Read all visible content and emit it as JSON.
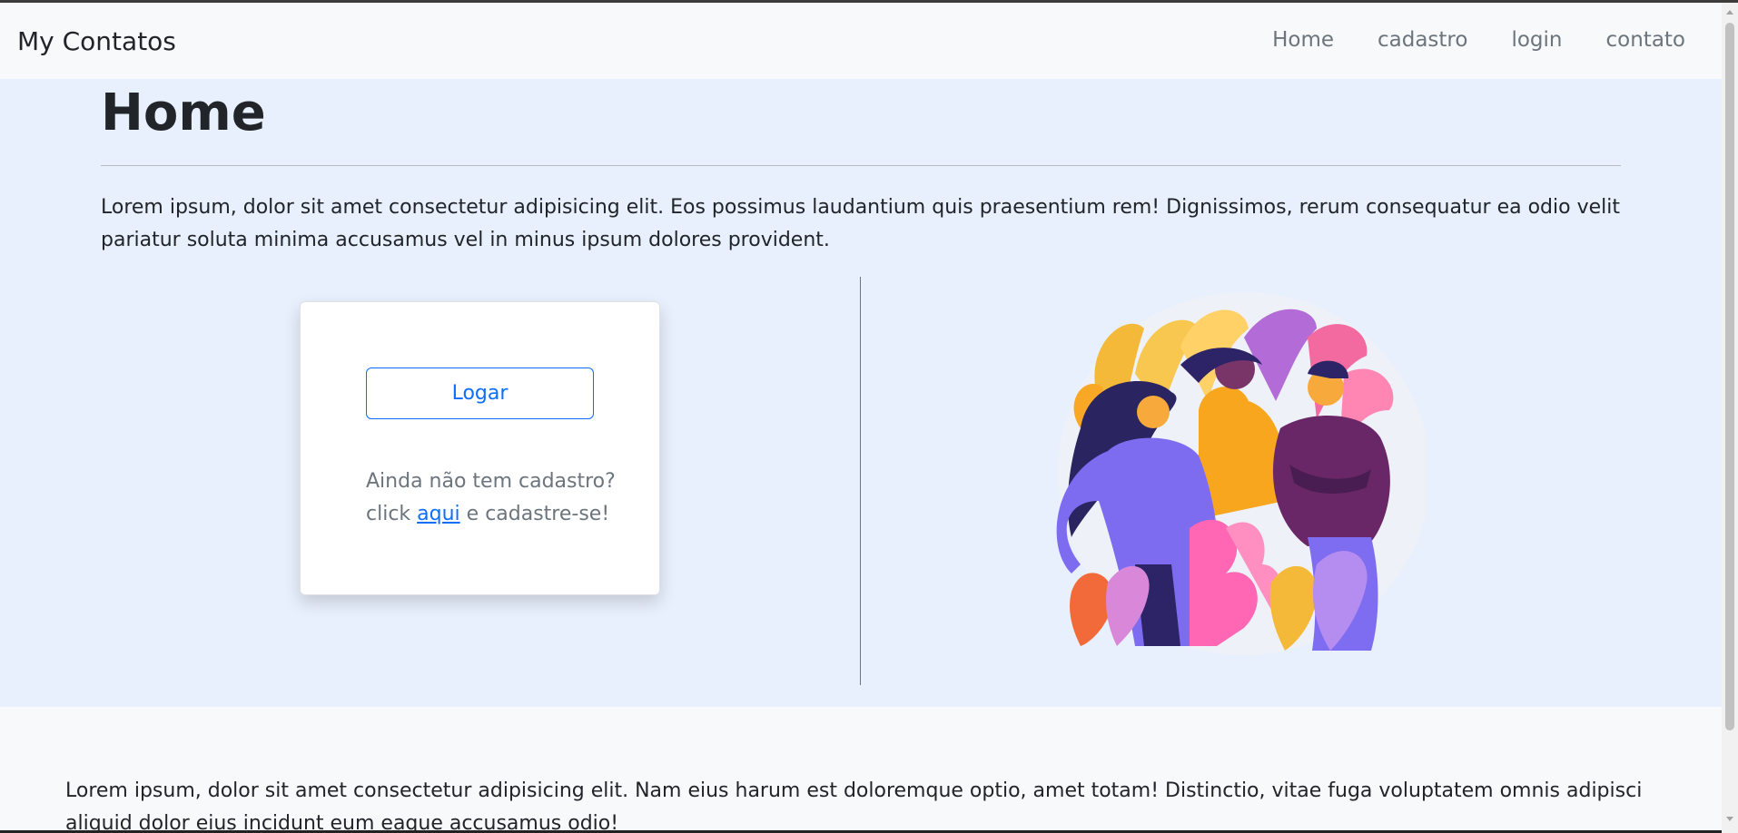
{
  "nav": {
    "brand": "My Contatos",
    "links": [
      {
        "label": "Home"
      },
      {
        "label": "cadastro"
      },
      {
        "label": "login"
      },
      {
        "label": "contato"
      }
    ]
  },
  "hero": {
    "title": "Home",
    "intro": "Lorem ipsum, dolor sit amet consectetur adipisicing elit. Eos possimus laudantium quis praesentium rem! Dignissimos, rerum consequatur ea odio velit pariatur soluta minima accusamus vel in minus ipsum dolores provident."
  },
  "card": {
    "button_label": "Logar",
    "note_line1": "Ainda não tem cadastro?",
    "note_prefix": "click",
    "note_link": "aqui",
    "note_suffix": "e cadastre-se!"
  },
  "footer": {
    "text": "Lorem ipsum, dolor sit amet consectetur adipisicing elit. Nam eius harum est doloremque optio, amet totam! Distinctio, vitae fuga voluptatem omnis adipisci aliquid dolor eius incidunt eum eaque accusamus odio!"
  },
  "colors": {
    "accent": "#0d6efd",
    "hero_background": "#e8f0fd",
    "page_background": "#f8f9fa"
  }
}
